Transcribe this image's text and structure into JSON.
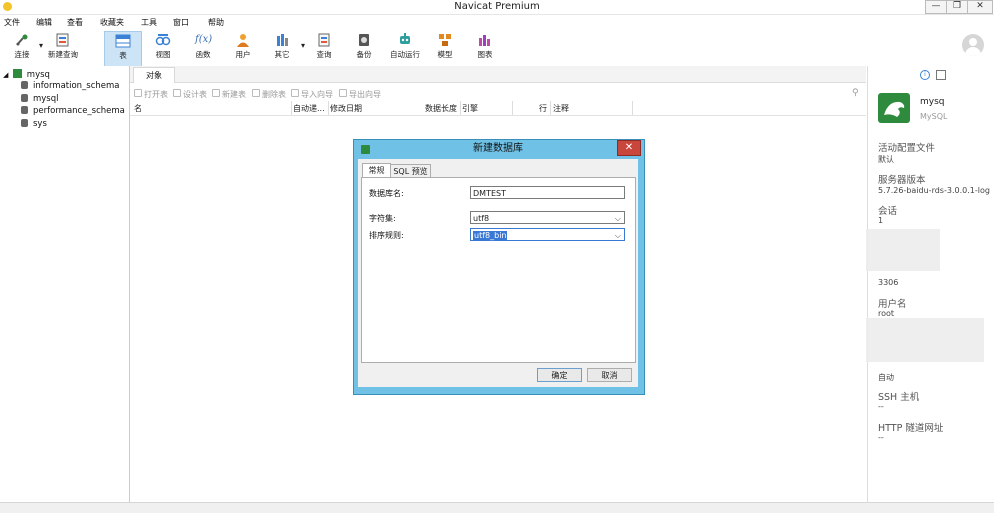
{
  "window": {
    "title": "Navicat Premium",
    "minimize": "—",
    "restore": "❐",
    "close": "✕"
  },
  "menu": [
    "文件",
    "编辑",
    "查看",
    "收藏夹",
    "工具",
    "窗口",
    "帮助"
  ],
  "toolbar": [
    {
      "label": "连接",
      "icon": "connect-icon"
    },
    {
      "label": "新建查询",
      "icon": "new-query-icon"
    },
    {
      "label": "表",
      "icon": "table-icon",
      "active": true
    },
    {
      "label": "视图",
      "icon": "view-icon"
    },
    {
      "label": "函数",
      "icon": "function-icon",
      "glyph": "f(x)"
    },
    {
      "label": "用户",
      "icon": "user-icon"
    },
    {
      "label": "其它",
      "icon": "other-icon"
    },
    {
      "label": "查询",
      "icon": "query-icon"
    },
    {
      "label": "备份",
      "icon": "backup-icon"
    },
    {
      "label": "自动运行",
      "icon": "robot-icon"
    },
    {
      "label": "模型",
      "icon": "model-icon"
    },
    {
      "label": "图表",
      "icon": "chart-icon"
    }
  ],
  "tree": {
    "connection": "mysq",
    "databases": [
      "information_schema",
      "mysql",
      "performance_schema",
      "sys"
    ]
  },
  "center": {
    "tab": "对象",
    "actions": [
      "打开表",
      "设计表",
      "新建表",
      "删除表",
      "导入向导",
      "导出向导"
    ],
    "columns": [
      "名",
      "自动递...",
      "修改日期",
      "数据长度",
      "引擎",
      "行",
      "注释"
    ]
  },
  "dialog": {
    "title": "新建数据库",
    "close": "✕",
    "tabs": [
      "常规",
      "SQL 预览"
    ],
    "fields": {
      "name_label": "数据库名:",
      "name_value": "DMTEST",
      "charset_label": "字符集:",
      "charset_value": "utf8",
      "collation_label": "排序规则:",
      "collation_value": "utf8_bin"
    },
    "ok": "确定",
    "cancel": "取消"
  },
  "right_panel": {
    "conn_name": "mysq",
    "conn_type": "MySQL",
    "items": [
      {
        "label": "活动配置文件",
        "value": "默认"
      },
      {
        "label": "服务器版本",
        "value": "5.7.26-baidu-rds-3.0.0.1-log"
      },
      {
        "label": "会话",
        "value": "1"
      },
      {
        "label": "",
        "value": "3306"
      },
      {
        "label": "用户名",
        "value": "root"
      },
      {
        "label": "",
        "value": "自动"
      },
      {
        "label": "SSH 主机",
        "value": "--"
      },
      {
        "label": "HTTP 隧道网址",
        "value": "--"
      }
    ]
  },
  "colors": {
    "accent": "#2e8b3e",
    "dialog_frame": "#6fc2e6",
    "selection": "#3a78d6",
    "close_red": "#c9463d"
  }
}
